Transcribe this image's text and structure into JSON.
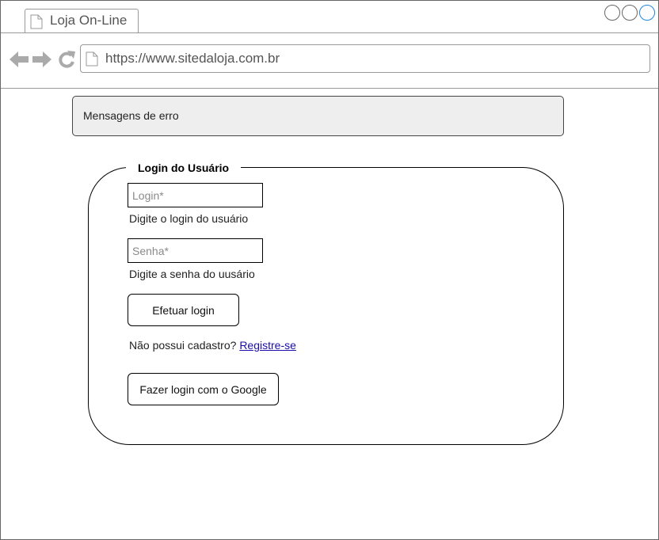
{
  "browser": {
    "tab_title": "Loja On-Line",
    "url": "https://www.sitedaloja.com.br",
    "icons": {
      "back": "arrow-left-icon",
      "forward": "arrow-right-icon",
      "reload": "reload-icon",
      "page": "page-icon"
    }
  },
  "error_panel": {
    "text": "Mensagens de erro"
  },
  "login": {
    "title": "Login do Usuário",
    "login_placeholder": "Login*",
    "login_hint": "Digite o login do usuário",
    "password_placeholder": "Senha*",
    "password_hint": "Digite a senha do uusário",
    "submit_label": "Efetuar login",
    "register_prompt": "Não possui cadastro?",
    "register_link": "Registre-se",
    "google_label": "Fazer login com o Google"
  },
  "colors": {
    "error_panel_bg": "#eeeeee",
    "link": "#1a0dab",
    "nav_icon": "#aaaaaa"
  }
}
